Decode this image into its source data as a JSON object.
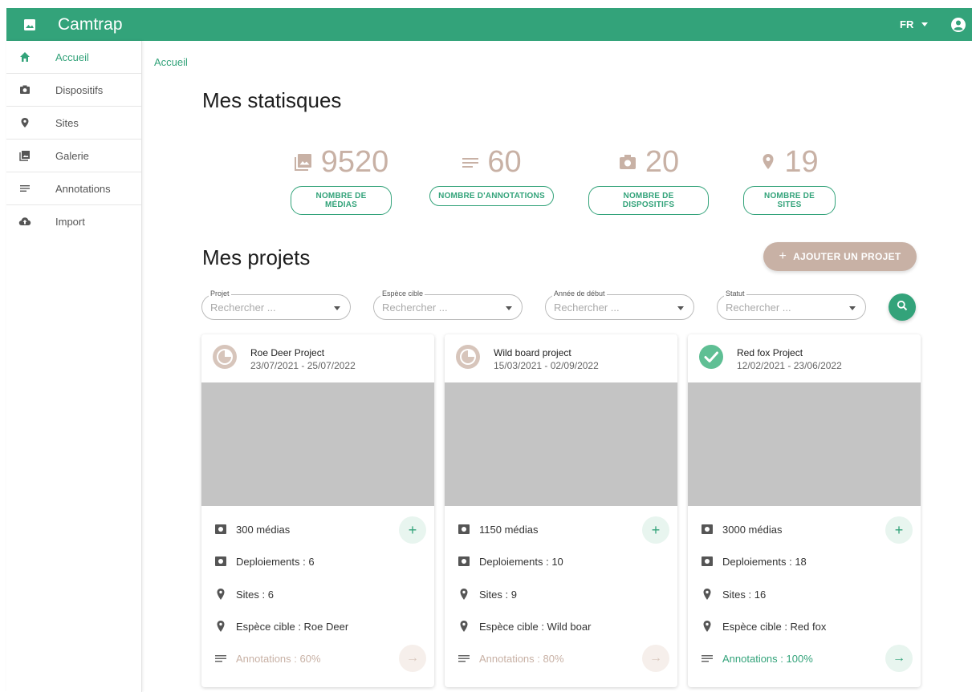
{
  "app": {
    "title": "Camtrap",
    "lang": "FR"
  },
  "sidebar": {
    "items": [
      {
        "label": "Accueil",
        "icon": "home-icon",
        "active": true
      },
      {
        "label": "Dispositifs",
        "icon": "camera-icon"
      },
      {
        "label": "Sites",
        "icon": "location-pin-icon"
      },
      {
        "label": "Galerie",
        "icon": "gallery-icon"
      },
      {
        "label": "Annotations",
        "icon": "lines-icon"
      },
      {
        "label": "Import",
        "icon": "cloud-upload-icon"
      }
    ]
  },
  "breadcrumb": "Accueil",
  "stats": {
    "heading": "Mes statisques",
    "items": [
      {
        "value": "9520",
        "label": "NOMBRE DE MÉDIAS",
        "icon": "image-icon"
      },
      {
        "value": "60",
        "label": "NOMBRE D'ANNOTATIONS",
        "icon": "lines-icon"
      },
      {
        "value": "20",
        "label": "NOMBRE DE DISPOSITIFS",
        "icon": "camera-icon"
      },
      {
        "value": "19",
        "label": "NOMBRE DE SITES",
        "icon": "location-pin-icon"
      }
    ]
  },
  "projects": {
    "heading": "Mes projets",
    "add_label": "AJOUTER UN PROJET",
    "filters": [
      {
        "label": "Projet",
        "placeholder": "Rechercher ..."
      },
      {
        "label": "Espèce cible",
        "placeholder": "Rechercher ..."
      },
      {
        "label": "Année de début",
        "placeholder": "Rechercher ..."
      },
      {
        "label": "Statut",
        "placeholder": "Rechercher ..."
      }
    ],
    "cards": [
      {
        "name": "Roe Deer Project",
        "dates": "23/07/2021 - 25/07/2022",
        "status": "in-progress",
        "medias": "300 médias",
        "deployments": "Deploiements : 6",
        "sites": "Sites : 6",
        "species": "Espèce cible : Roe Deer",
        "annotations": "Annotations : 60%"
      },
      {
        "name": "Wild board project",
        "dates": "15/03/2021 - 02/09/2022",
        "status": "in-progress",
        "medias": "1150 médias",
        "deployments": "Deploiements : 10",
        "sites": "Sites : 9",
        "species": "Espèce cible : Wild boar",
        "annotations": "Annotations : 80%"
      },
      {
        "name": "Red fox Project",
        "dates": "12/02/2021 -  23/06/2022",
        "status": "complete",
        "medias": "3000 médias",
        "deployments": "Deploiements : 18",
        "sites": "Sites : 16",
        "species": "Espèce cible : Red fox",
        "annotations": "Annotations : 100%"
      }
    ]
  },
  "colors": {
    "primary": "#33a37a",
    "accent": "#c8b1a5",
    "image_placeholder": "#c4c4c4"
  }
}
